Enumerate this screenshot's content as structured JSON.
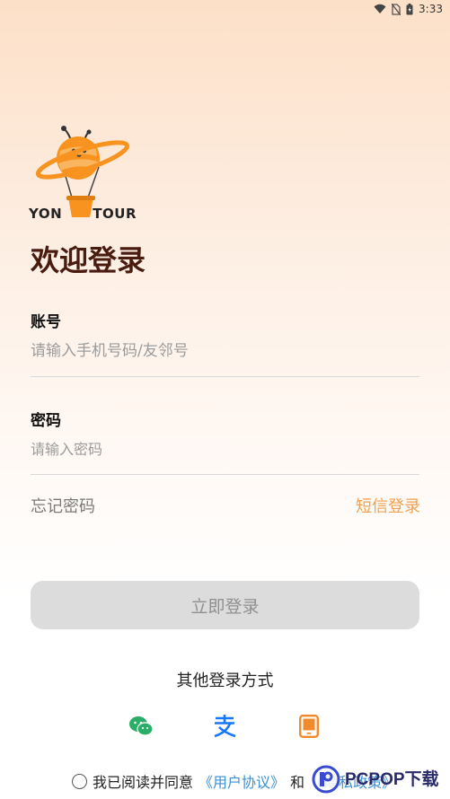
{
  "status_bar": {
    "time": "3:33"
  },
  "logo": {
    "text_left": "YON",
    "text_right": "TOUR"
  },
  "welcome_title": "欢迎登录",
  "account": {
    "label": "账号",
    "placeholder": "请输入手机号码/友邻号",
    "value": ""
  },
  "password": {
    "label": "密码",
    "placeholder": "请输入密码",
    "value": ""
  },
  "forgot_password": "忘记密码",
  "sms_login": "短信登录",
  "login_button": "立即登录",
  "other_login_title": "其他登录方式",
  "social_icons": [
    "wechat-icon",
    "alipay-icon",
    "phone-icon"
  ],
  "agreement": {
    "prefix": "我已阅读并同意",
    "user_agreement": "《用户协议》",
    "and": "和",
    "privacy_policy": "《隐私政策》"
  },
  "watermark": {
    "text": "PCPOP下载"
  },
  "colors": {
    "accent": "#f0a050",
    "title": "#4a1c10",
    "link": "#3c8fd6",
    "wechat": "#2aae67",
    "alipay": "#1677ff",
    "phone": "#f08a2c"
  }
}
